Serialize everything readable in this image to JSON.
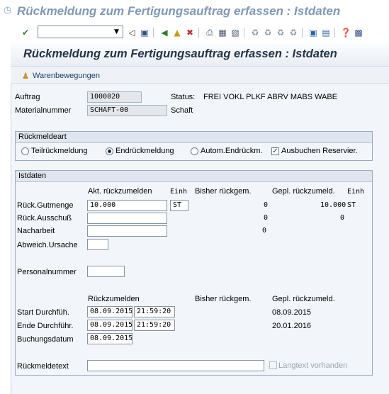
{
  "window": {
    "title": "Rückmeldung zum Fertigungsauftrag erfassen : Istdaten"
  },
  "toolbar": {
    "icons": [
      "enter-icon",
      "command-dropdown-icon",
      "back-icon",
      "save-icon",
      "back-nav-icon",
      "exit-icon",
      "cancel-icon",
      "print-icon",
      "find-icon",
      "find-next-icon",
      "first-page-icon",
      "previous-page-icon",
      "next-page-icon",
      "last-page-icon",
      "create-session-icon",
      "shortcut-icon",
      "help-icon",
      "layout-icon"
    ],
    "command_value": ""
  },
  "main": {
    "title": "Rückmeldung zum Fertigungsauftrag erfassen : Istdaten",
    "app_button": "Warenbewegungen"
  },
  "header_fields": {
    "auftrag_label": "Auftrag",
    "auftrag_value": "1000020",
    "status_label": "Status:",
    "status_value": "FREI VOKL PLKF ABRV MABS WABE",
    "material_label": "Materialnummer",
    "material_value": "SCHAFT-00",
    "material_desc": "Schaft"
  },
  "rueckmeldeart": {
    "title": "Rückmeldeart",
    "options": [
      "Teilrückmeldung",
      "Endrückmeldung",
      "Autom.Endrückm."
    ],
    "selected": "Endrückmeldung",
    "checkbox_label": "Ausbuchen Reservier.",
    "checkbox_checked": true
  },
  "istdaten": {
    "title": "Istdaten",
    "col_akt": "Akt. rückzumelden",
    "col_einh": "Einh",
    "col_bisher": "Bisher rückgem.",
    "col_gepl": "Gepl. rückzumeld.",
    "col_einh2": "Einh",
    "rows": [
      {
        "label": "Rück.Gutmenge",
        "value": "10.000",
        "unit": "ST",
        "bisher": "0",
        "gepl": "10.000",
        "unit2": "ST"
      },
      {
        "label": "Rück.Ausschuß",
        "value": "",
        "unit": "",
        "bisher": "0",
        "gepl": "0",
        "unit2": ""
      },
      {
        "label": "Nacharbeit",
        "value": "",
        "unit": "",
        "bisher": "0",
        "gepl": "",
        "unit2": ""
      }
    ],
    "abweich_label": "Abweich.Ursache",
    "abweich_value": "",
    "personal_label": "Personalnummer",
    "personal_value": "",
    "rueckzumelden_label": "Rückzumelden",
    "bisher_label": "Bisher rückgem.",
    "gepl_label": "Gepl. rückzumeld.",
    "start_label": "Start Durchfüh.",
    "start_date": "08.09.2015",
    "start_time": "21:59:20",
    "start_gepl": "08.09.2015",
    "ende_label": "Ende Durchführ.",
    "ende_date": "08.09.2015",
    "ende_time": "21:59:20",
    "ende_gepl": "20.01.2016",
    "buchung_label": "Buchungsdatum",
    "buchung_date": "08.09.2015",
    "text_label": "Rückmeldetext",
    "text_value": "",
    "langtext_label": "Langtext vorhanden"
  }
}
